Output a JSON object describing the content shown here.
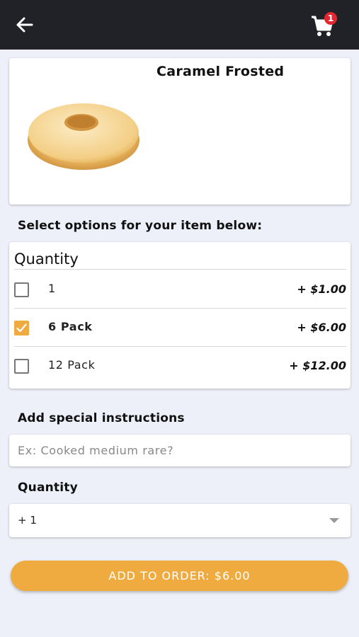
{
  "header": {
    "cart_count": "1",
    "background_color": "#212227"
  },
  "product": {
    "title": "Caramel Frosted"
  },
  "options_prompt": "Select options for your item below:",
  "options": {
    "heading": "Quantity",
    "items": [
      {
        "label": "1",
        "price": "+ $1.00",
        "checked": false
      },
      {
        "label": "6 Pack",
        "price": "+ $6.00",
        "checked": true
      },
      {
        "label": "12 Pack",
        "price": "+ $12.00",
        "checked": false
      }
    ]
  },
  "instructions": {
    "label": "Add special instructions",
    "placeholder": "Ex: Cooked medium rare?",
    "value": ""
  },
  "quantity": {
    "label": "Quantity",
    "selected": "+ 1"
  },
  "add_button": {
    "label": "ADD TO ORDER: $6.00"
  },
  "colors": {
    "accent": "#efab3f",
    "badge": "#e3262f",
    "page_background": "#eef0f9"
  }
}
